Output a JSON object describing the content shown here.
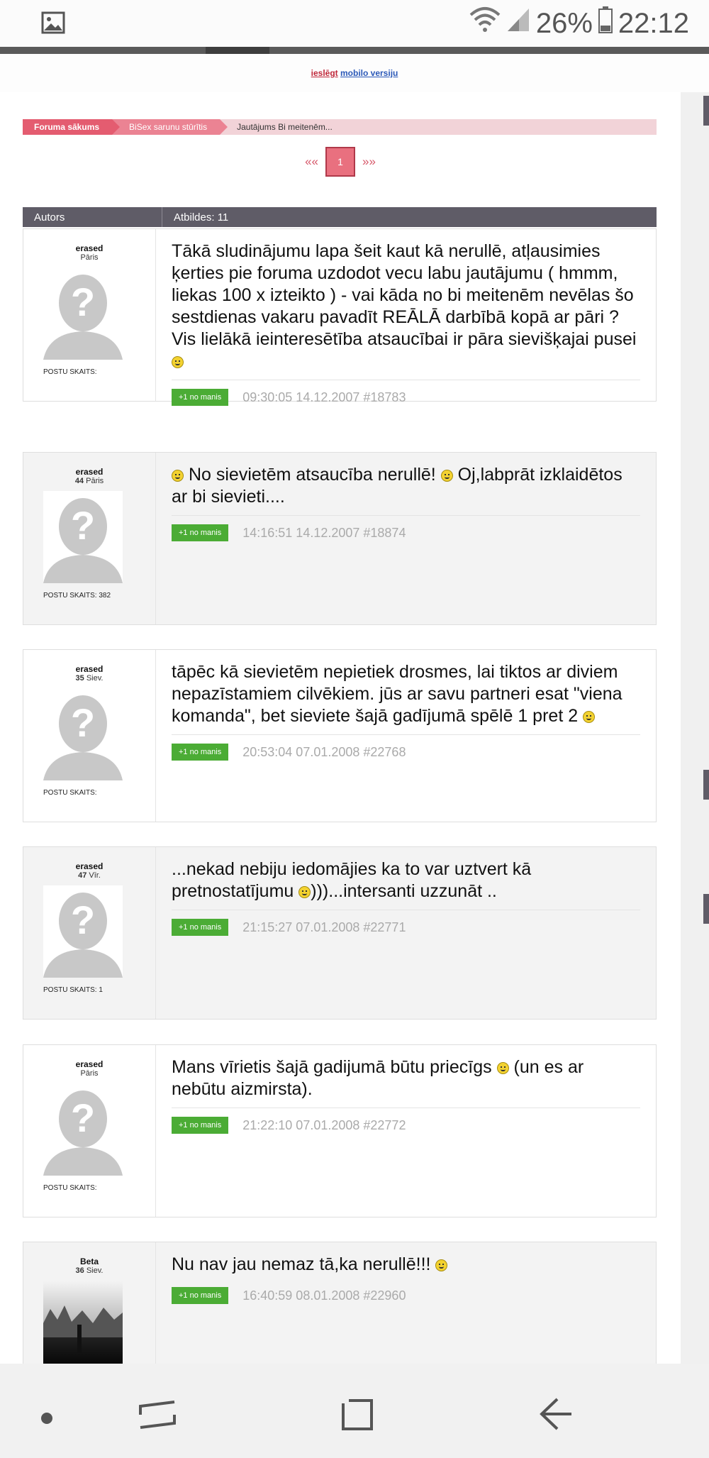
{
  "status_bar": {
    "battery": "26%",
    "time": "22:12",
    "icons": [
      "gallery-icon",
      "wifi-icon",
      "signal-icon",
      "battery-icon"
    ]
  },
  "mobile_link": {
    "part1": "ieslēgt",
    "part2": "mobilo versiju"
  },
  "breadcrumb": {
    "items": [
      "Foruma sākums",
      "BiSex sarunu stūrītis",
      "Jautājums Bi meitenēm..."
    ]
  },
  "pagination": {
    "prev": "««",
    "current": "1",
    "next": "»»"
  },
  "table_header": {
    "author": "Autors",
    "replies": "Atbildes: 11"
  },
  "posts": [
    {
      "author": "erased",
      "age": "",
      "role": "Pāris",
      "posts_label": "POSTU SKAITS:",
      "text": "Tākā sludinājumu lapa šeit kaut kā nerullē, atļausimies ķerties pie foruma uzdodot vecu labu jautājumu ( hmmm, liekas 100 x izteikto ) - vai kāda no bi meitenēm nevēlas šo sestdienas vakaru pavadīt REĀLĀ darbībā kopā ar pāri ? Vis lielākā ieinteresētība atsaucībai ir pāra sievišķajai pusei",
      "plus": "+1 no manis",
      "stamp": "09:30:05 14.12.2007 #18783"
    },
    {
      "author": "erased",
      "age": "44",
      "role": "Pāris",
      "posts_label": "POSTU SKAITS: 382",
      "text_lead": "",
      "text": "No sievietēm atsaucība nerullē!",
      "text2": "Oj,labprāt izklaidētos ar bi sievieti....",
      "plus": "+1 no manis",
      "stamp": "14:16:51 14.12.2007 #18874"
    },
    {
      "author": "erased",
      "age": "35",
      "role": "Siev.",
      "posts_label": "POSTU SKAITS:",
      "text": "tāpēc kā sievietēm nepietiek drosmes, lai tiktos ar diviem nepazīstamiem cilvēkiem. jūs ar savu partneri esat \"viena komanda\", bet sieviete šajā gadījumā spēlē 1 pret 2",
      "plus": "+1 no manis",
      "stamp": "20:53:04 07.01.2008 #22768"
    },
    {
      "author": "erased",
      "age": "47",
      "role": "Vīr.",
      "posts_label": "POSTU SKAITS: 1",
      "text": "...nekad nebiju iedomājies ka to var uztvert kā pretnostatījumu",
      "text2": ")))...intersanti uzzunāt ..",
      "plus": "+1 no manis",
      "stamp": "21:15:27 07.01.2008 #22771"
    },
    {
      "author": "erased",
      "age": "",
      "role": "Pāris",
      "posts_label": "POSTU SKAITS:",
      "text": "Mans vīrietis šajā gadijumā būtu priecīgs",
      "text2": "(un es ar nebūtu aizmirsta).",
      "plus": "+1 no manis",
      "stamp": "21:22:10 07.01.2008 #22772"
    },
    {
      "author": "Beta",
      "age": "36",
      "role": "Siev.",
      "posts_label": "",
      "text": "Nu nav jau nemaz tā,ka nerullē!!!",
      "plus": "+1 no manis",
      "stamp": "16:40:59 08.01.2008 #22960"
    }
  ],
  "nav_bar": {
    "icons": [
      "home-dot-icon",
      "recents-icon",
      "overview-icon",
      "back-icon"
    ]
  }
}
